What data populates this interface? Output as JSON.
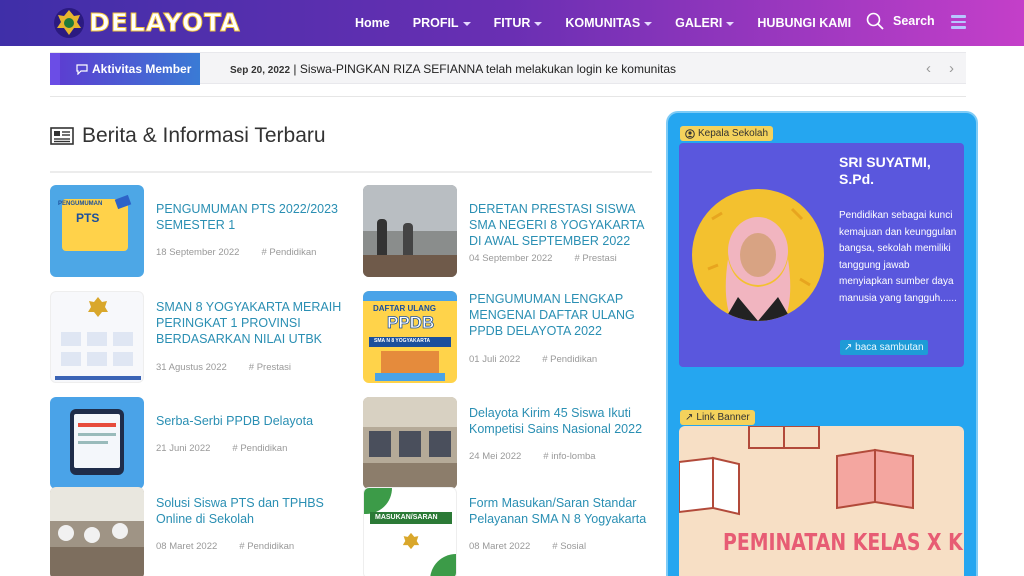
{
  "brand": {
    "name": "DELAYOTA"
  },
  "nav": {
    "items": [
      {
        "label": "Home",
        "dropdown": false
      },
      {
        "label": "PROFIL",
        "dropdown": true
      },
      {
        "label": "FITUR",
        "dropdown": true
      },
      {
        "label": "KOMUNITAS",
        "dropdown": true
      },
      {
        "label": "GALERI",
        "dropdown": true
      },
      {
        "label": "HUBUNGI KAMI",
        "dropdown": false
      }
    ],
    "search_label": "Search"
  },
  "activity": {
    "label": "Aktivitas Member",
    "date": "Sep 20, 2022",
    "text": "| Siswa-PINGKAN RIZA SEFIANNA   telah melakukan login ke komunitas"
  },
  "news": {
    "section_title": "Berita & Informasi Terbaru",
    "items": [
      {
        "title": "PENGUMUMAN PTS 2022/2023 SEMESTER 1",
        "date": "18 September 2022",
        "tag": "# Pendidikan"
      },
      {
        "title": "DERETAN PRESTASI SISWA SMA NEGERI 8 YOGYAKARTA DI AWAL SEPTEMBER 2022",
        "date": "04 September 2022",
        "tag": "# Prestasi"
      },
      {
        "title": "SMAN 8 YOGYAKARTA MERAIH PERINGKAT 1 PROVINSI BERDASARKAN NILAI UTBK",
        "date": "31 Agustus 2022",
        "tag": "# Prestasi"
      },
      {
        "title": "PENGUMUMAN LENGKAP MENGENAI DAFTAR ULANG PPDB DELAYOTA 2022",
        "date": "01 Juli 2022",
        "tag": "# Pendidikan"
      },
      {
        "title": "Serba-Serbi PPDB Delayota",
        "date": "21 Juni 2022",
        "tag": "# Pendidikan"
      },
      {
        "title": "Delayota Kirim 45 Siswa Ikuti Kompetisi Sains Nasional 2022",
        "date": "24 Mei 2022",
        "tag": "# info-lomba"
      },
      {
        "title": "Solusi Siswa PTS dan TPHBS Online di Sekolah",
        "date": "08 Maret 2022",
        "tag": "# Pendidikan"
      },
      {
        "title": "Form Masukan/Saran Standar Pelayanan SMA N 8 Yogyakarta",
        "date": "08 Maret 2022",
        "tag": "# Sosial"
      }
    ],
    "thumb_texts": {
      "pts_banner": "PENGUMUMAN",
      "pts_word": "PTS",
      "ppdb_top": "DAFTAR ULANG",
      "ppdb_word": "PPDB",
      "ppdb_sub": "SMA N 8 YOGYAKARTA",
      "form_word": "MASUKAN/SARAN"
    }
  },
  "sidebar": {
    "principal": {
      "badge": "Kepala Sekolah",
      "name": "SRI SUYATMI, S.Pd.",
      "quote": "Pendidikan sebagai kunci kemajuan dan keunggulan bangsa, sekolah memiliki tanggung jawab menyiapkan sumber daya manusia yang tangguh......",
      "read_more": "baca sambutan"
    },
    "banner": {
      "badge": "Link Banner",
      "text": "PEMINATAN KELAS X KE KELAS XI"
    }
  },
  "colors": {
    "header_start": "#3f2fa8",
    "header_end": "#c43fc9",
    "link": "#2a8fb3",
    "side_panel": "#25a6f0",
    "principal_card": "#5a57dd",
    "badge": "#f4d25c",
    "banner_text": "#e75c74"
  },
  "icons": {
    "logo": "school-emblem-icon",
    "search": "search-icon",
    "menu": "hamburger-menu-icon",
    "activity": "chat-icon",
    "news": "newspaper-icon",
    "principal": "user-circle-icon",
    "link": "external-link-icon",
    "prev": "chevron-left-icon",
    "next": "chevron-right-icon"
  }
}
